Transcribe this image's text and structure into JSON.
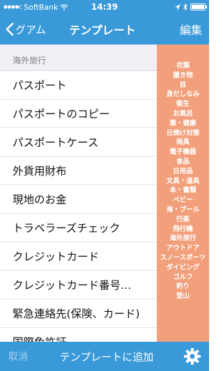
{
  "status_bar": {
    "carrier": "SoftBank",
    "time": "14:39",
    "signal_icon": "signal-bars-icon",
    "wifi_icon": "wifi-icon",
    "location_icon": "location-arrow-icon",
    "bluetooth_icon": "bluetooth-icon",
    "battery_icon": "battery-icon"
  },
  "nav": {
    "back_label": "グアム",
    "title": "テンプレート",
    "edit_label": "編集"
  },
  "list": {
    "section_title": "海外旅行",
    "items": [
      "パスポート",
      "パスポートのコピー",
      "パスポートケース",
      "外貨用財布",
      "現地のお金",
      "トラベラーズチェック",
      "クレジットカード",
      "クレジットカード番号…",
      "緊急連絡先(保険、カード)",
      "国際免許証"
    ]
  },
  "index": {
    "items": [
      "衣類",
      "履き物",
      "目",
      "身だしなみ",
      "衛生",
      "お風呂",
      "薬・健康",
      "日焼け対策",
      "雨具",
      "電子機器",
      "食品",
      "日用品",
      "文具・道具",
      "本・書類",
      "ベビー",
      "海・プール",
      "行楽",
      "飛行機",
      "海外旅行",
      "アウトドア",
      "スノースポーツ",
      "ダイビング",
      "ゴルフ",
      "釣り",
      "登山"
    ]
  },
  "toolbar": {
    "cancel_label": "取消",
    "add_label": "テンプレートに追加",
    "settings_icon": "gear-icon"
  },
  "colors": {
    "bar_blue": "#3a9ad9",
    "index_orange": "#f2a07c",
    "section_gray": "#f0f0f5"
  }
}
